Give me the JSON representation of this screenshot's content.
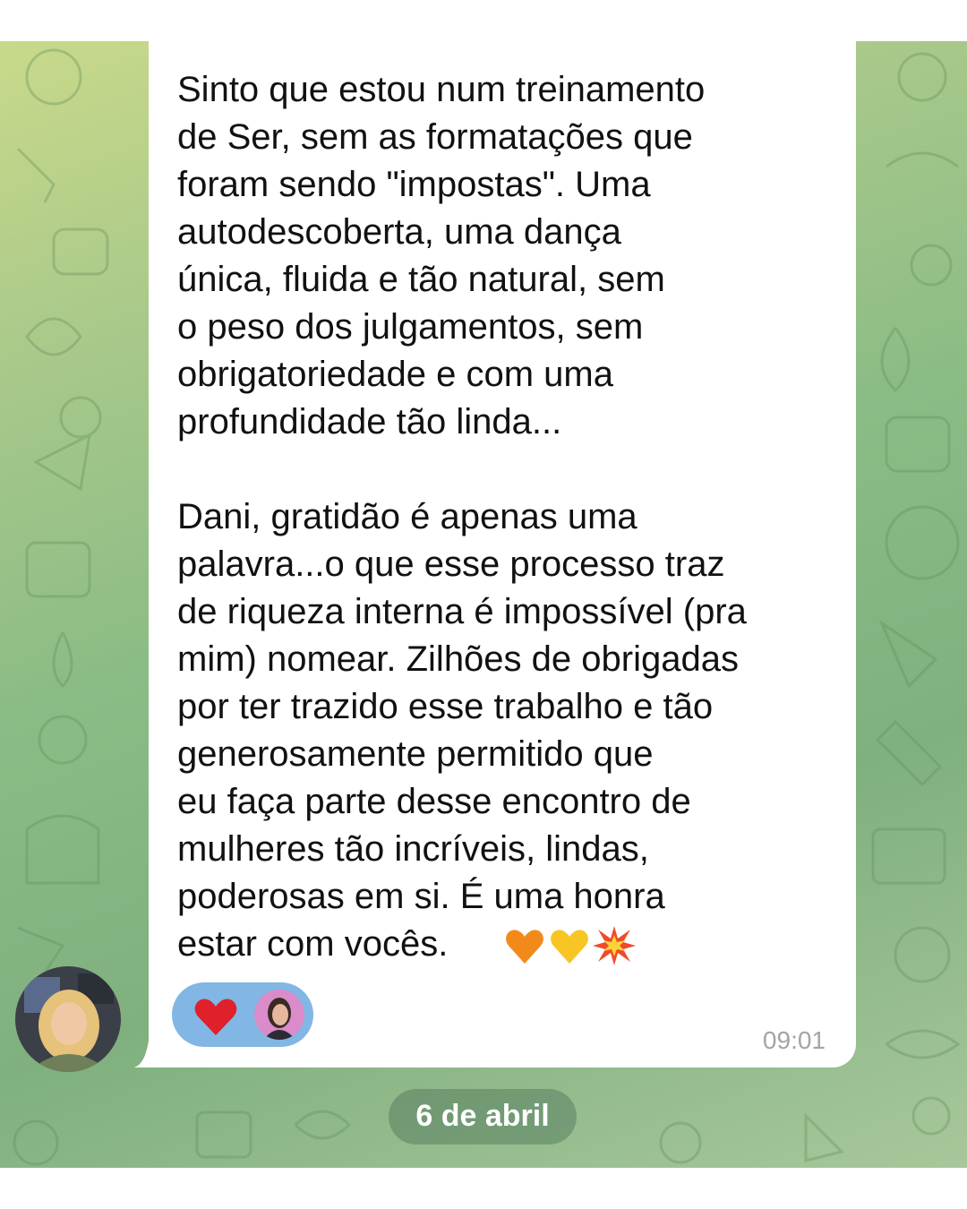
{
  "message": {
    "text": "Sinto que estou num treinamento\nde Ser, sem as formatações que\nforam sendo  \"impostas\". Uma\nautodescoberta, uma dança\núnica,  fluida e tão natural,  sem\no peso dos julgamentos, sem\nobrigatoriedade e com uma\nprofundidade tão linda...\n\nDani, gratidão é apenas uma\npalavra...o que esse processo traz\nde riqueza interna é impossível (pra\nmim) nomear. Zilhões de obrigadas\npor ter trazido esse trabalho e tão\ngenerosamente permitido que\neu faça parte desse encontro de\nmulheres tão incríveis,  lindas,\npoderosas em si. É uma honra\nestar com vocês.",
    "trailing_emojis": [
      "orange-heart-icon",
      "yellow-heart-icon",
      "collision-icon"
    ],
    "time": "09:01"
  },
  "reaction": {
    "emoji": "red-heart-icon",
    "reactor": "reactor-avatar"
  },
  "date_separator": "6 de abril",
  "colors": {
    "bubble": "#ffffff",
    "reaction_pill": "#82b6e4",
    "timestamp": "#a4a4a4",
    "heart_red": "#e0202a",
    "heart_orange": "#f28a1a",
    "heart_yellow": "#f7c624"
  }
}
